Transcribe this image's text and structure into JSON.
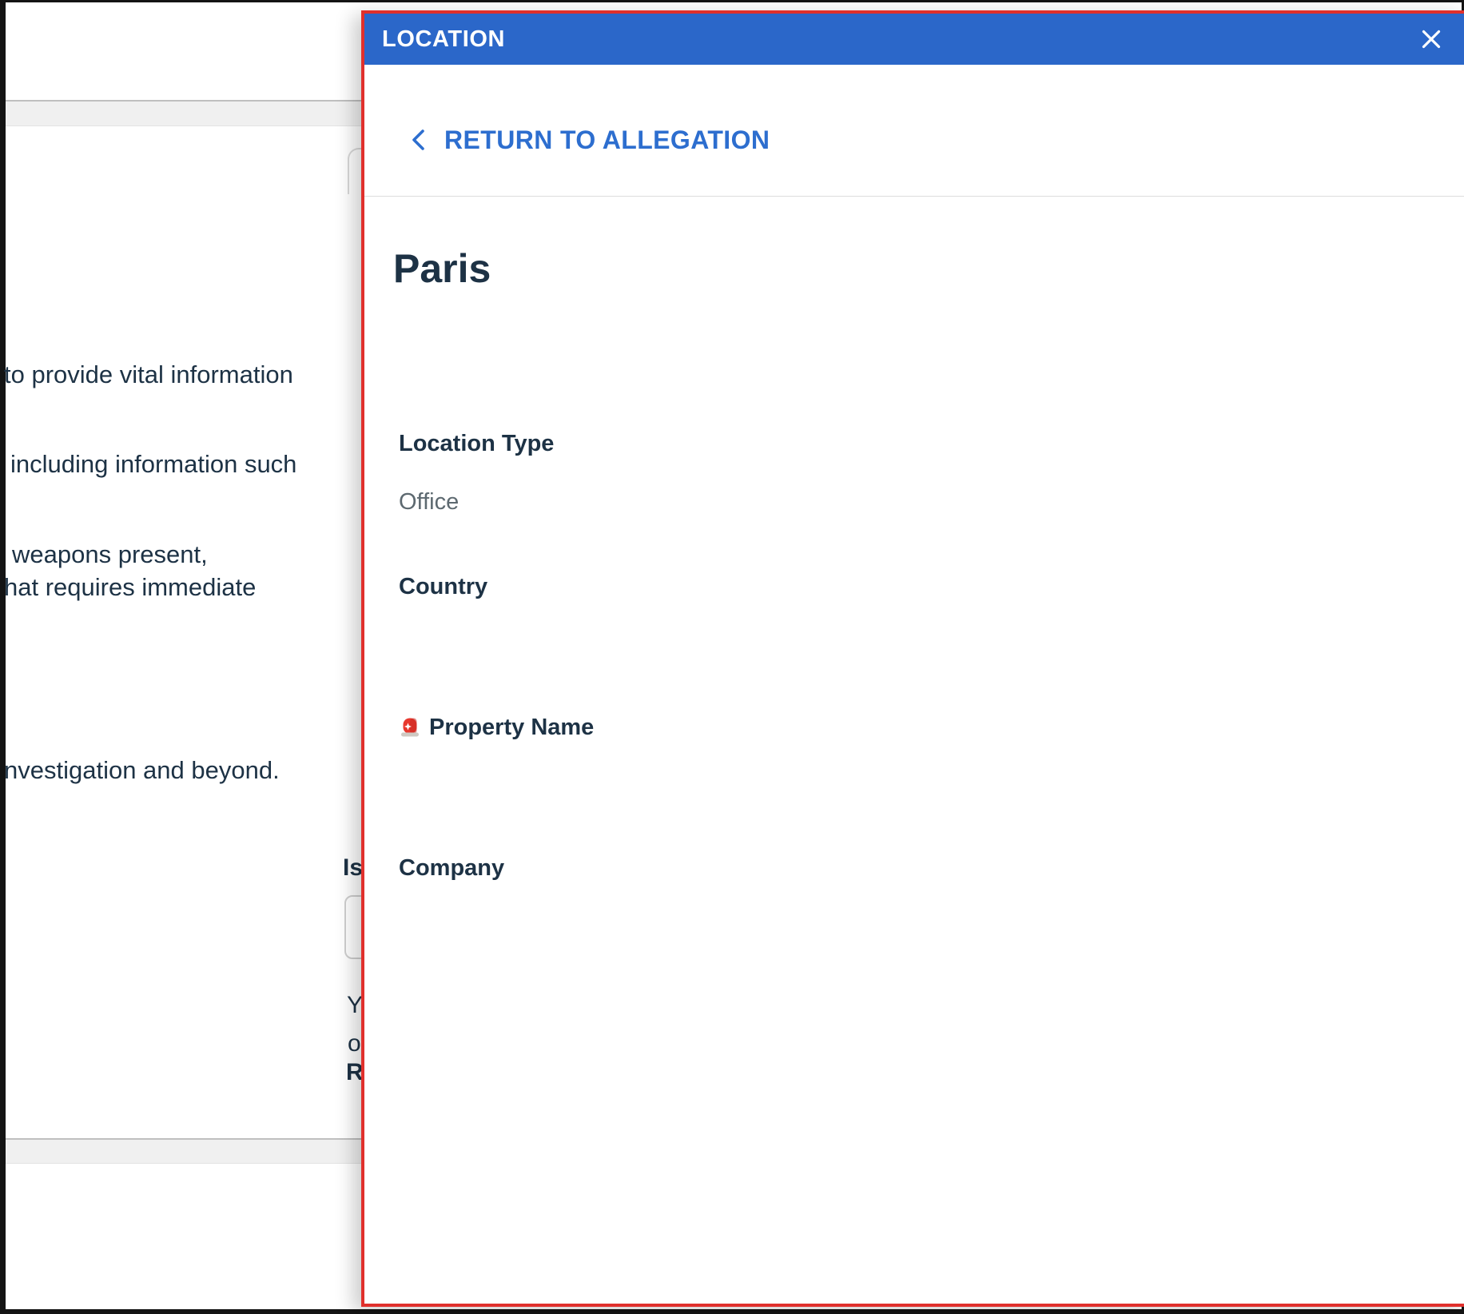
{
  "drawer": {
    "title": "LOCATION",
    "back_link_label": "RETURN TO ALLEGATION",
    "heading": "Paris",
    "fields": [
      {
        "label": "Location Type",
        "value": "Office"
      },
      {
        "label": "Country",
        "value": ""
      },
      {
        "label": "Property Name",
        "value": "",
        "icon": "alert-light-icon"
      },
      {
        "label": "Company",
        "value": ""
      }
    ]
  },
  "background": {
    "text_fragments": [
      "to provide vital information",
      "including information such",
      "weapons present,",
      "hat requires immediate",
      "nvestigation and beyond."
    ],
    "form_label_fragment": "Is",
    "clipped_letters": [
      "Y",
      "o",
      "R"
    ]
  },
  "colors": {
    "header_blue": "#2b67c9",
    "link_blue": "#2d6ecf",
    "highlight_red": "#e0302c",
    "text_navy": "#1d3245",
    "value_gray": "#5d6970",
    "band_gray": "#f0f0f0"
  }
}
